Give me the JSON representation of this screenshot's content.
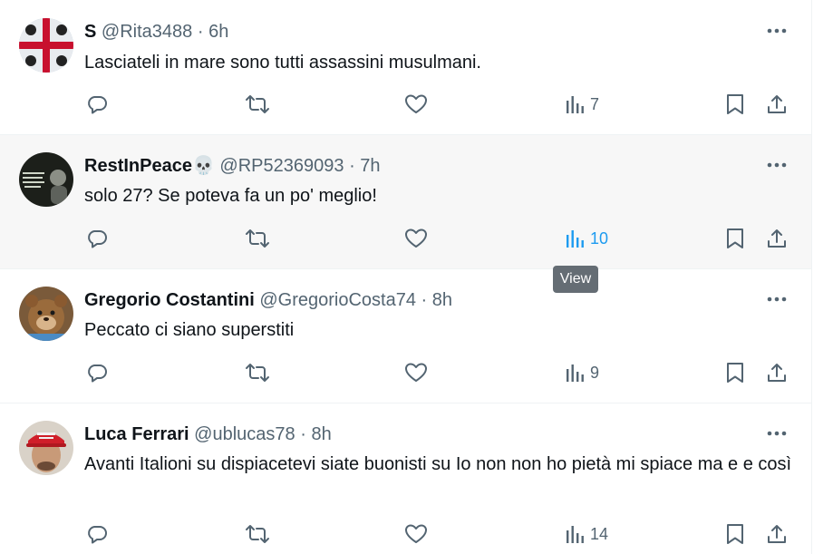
{
  "tweets": [
    {
      "display_name": "S",
      "handle": "@Rita3488",
      "time": "6h",
      "text": "Lasciateli in mare sono tutti assassini musulmani.",
      "views": "7"
    },
    {
      "display_name": "RestInPeace💀",
      "handle": "@RP52369093",
      "time": "7h",
      "text": "solo 27? Se poteva fa un po' meglio!",
      "views": "10"
    },
    {
      "display_name": "Gregorio Costantini",
      "handle": "@GregorioCosta74",
      "time": "8h",
      "text": "Peccato ci siano superstiti",
      "views": "9"
    },
    {
      "display_name": "Luca Ferrari",
      "handle": "@ublucas78",
      "time": "8h",
      "text": "Avanti Italioni su dispiacetevi siate buonisti su Io non non ho pietà mi spiace ma e e così",
      "views": "14"
    }
  ],
  "separator": "·",
  "tooltip": "View",
  "colors": {
    "accent": "#1d9bf0",
    "muted": "#536471",
    "hover_bg": "#f7f7f7"
  },
  "icons": [
    "reply-icon",
    "retweet-icon",
    "like-icon",
    "views-icon",
    "bookmark-icon",
    "share-icon",
    "more-icon"
  ]
}
